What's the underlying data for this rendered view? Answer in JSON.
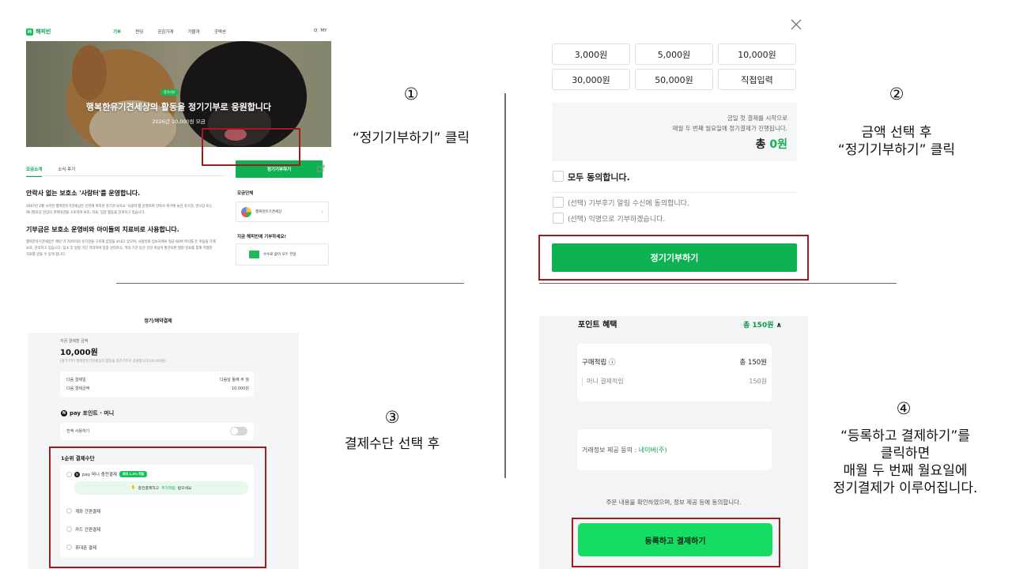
{
  "panel1": {
    "logo": "해피빈",
    "logo_mark": "H",
    "nav": [
      "기부",
      "펀딩",
      "공감가게",
      "가볼까",
      "굿액션"
    ],
    "nav_search": "Q",
    "nav_my": "MY",
    "hero_badge": "정기기부",
    "hero_title": "행복한유기견세상의 활동을 정기기부로 응원합니다",
    "hero_sub": "2026년 10,000원 모금",
    "tabs": [
      "모금소개",
      "소식·후기"
    ],
    "donate_button": "정기기부하기",
    "heading1": "안락사 없는 보호소 '사랑터'를 운영합니다.",
    "text1": "2007년 2월 시작한 행복한유기견세상은 인천에 위치한 유기견 보호소 '사랑터'를 운영하며 안락사 위기에 놓인 유기견, 번식장 또는 애니멀호딩 현장의 피학대견을 구조하여 보호, 치료, 입양 활동을 전개하고 있습니다.",
    "heading2": "기부금은 보호소 운영비와 아이들의 치료비로 사용합니다.",
    "text2": "행복한유기견세상은 매년 약 70마리의 유기견을 구조해 입양을 보내고 있으며, 사랑터와 임보처에서 평균 60여 마리를 돈 마음을 다해 보호, 관리하고 있습니다. 입소 후 일정 기간 격리하여 집중 관리하고, 격리 기간 동안 건강 이상이 발견되면 병원 진료를 통해 적절한 치료를 받을 수 있게 합니다.",
    "org_label": "모금단체",
    "org_name": "행복한유기견세상",
    "now_label": "지금 해피빈에 기부하세요!",
    "now_text": "수수료 없이 모두 전달"
  },
  "panel2": {
    "amounts": [
      "3,000원",
      "5,000원",
      "10,000원",
      "30,000원",
      "50,000원",
      "직접입력"
    ],
    "info_line1": "금일 첫 결제를 시작으로",
    "info_line2": "매월 두 번째 월요일에 정기결제가 진행됩니다.",
    "total_label": "총",
    "total_value": "0원",
    "agree_all": "모두 동의합니다.",
    "options": [
      "(선택) 기부후기 알림 수신에 동의합니다.",
      "(선택) 익명으로 기부하겠습니다."
    ],
    "donate_button": "정기기부하기"
  },
  "panel3": {
    "title": "정기/예약결제",
    "amount_label": "지금 결제할 금액",
    "amount": "10,000원",
    "desc": "[정기기부] 행복한유기견세상의 활동을 정기기부로 응원합니다(10,000원)",
    "next_date_label": "다음 결제일",
    "next_date_value": "다음달 둘째 주 월",
    "next_amount_label": "다음 결제금액",
    "next_amount_value": "10,000원",
    "npay_title": "pay 포인트 · 머니",
    "npay_mark": "N",
    "use_all": "전액 사용하기",
    "method_title": "1순위 결제수단",
    "method1": "pay 머니 충전결제",
    "method1_tag": "최대 1.5% 적립",
    "promo_pre": "충전결제하고",
    "promo_hl": "추가적립",
    "promo_post": "받으세요",
    "methods": [
      "계좌 간편결제",
      "카드 간편결제",
      "휴대폰 결제"
    ]
  },
  "panel4": {
    "title": "포인트 혜택",
    "total": "총 150원",
    "caret": "∧",
    "buy_label": "구매적립 ⓘ",
    "buy_value": "총 150원",
    "sub_label": "머니 결제적립",
    "sub_value": "150원",
    "consent_pre": "거래정보 제공 동의 :",
    "consent_link": "네이버(주)",
    "confirm": "주문 내용을 확인하였으며, 정보 제공 등에 동의합니다.",
    "register_button": "등록하고 결제하기"
  },
  "captions": {
    "c1_num": "①",
    "c1_text": "“정기기부하기” 클릭",
    "c2_num": "②",
    "c2_line1": "금액 선택 후",
    "c2_line2": "“정기기부하기” 클릭",
    "c3_num": "③",
    "c3_text": "결제수단 선택 후",
    "c4_num": "④",
    "c4_line1": "“등록하고 결제하기”를",
    "c4_line2": "클릭하면",
    "c4_line3": "매월 두 번째 월요일에",
    "c4_line4": "정기결제가 이루어집니다."
  },
  "colors": {
    "brand_green": "#0fb253",
    "register_green": "#17dc64",
    "highlight_red": "#a11a1f"
  }
}
